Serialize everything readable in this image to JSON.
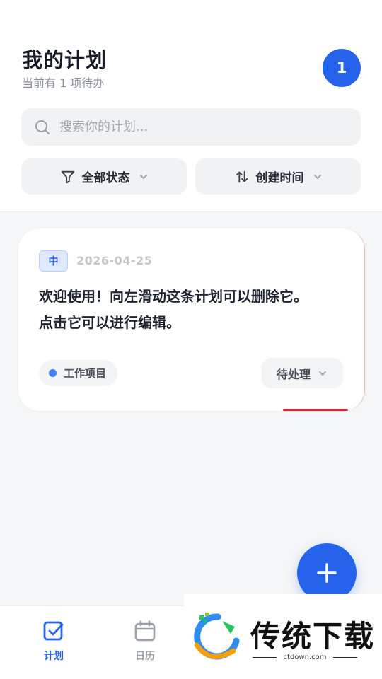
{
  "header": {
    "title": "我的计划",
    "subtitle": "当前有 1 项待办",
    "count_badge": "1"
  },
  "search": {
    "placeholder": "搜索你的计划...",
    "value": "",
    "icon": "search-icon"
  },
  "filters": {
    "status": {
      "label": "全部状态",
      "icon": "filter-icon"
    },
    "sort": {
      "label": "创建时间",
      "icon": "sort-icon"
    }
  },
  "plans": [
    {
      "priority": "中",
      "date": "2026-04-25",
      "content": "欢迎使用！向左滑动这条计划可以删除它。\n点击它可以进行编辑。",
      "category": "工作项目",
      "category_color": "#3b82f6",
      "status": "待处理"
    }
  ],
  "fab": {
    "icon": "plus-icon"
  },
  "tabbar": {
    "items": [
      {
        "label": "计划",
        "icon": "checkbox-icon",
        "active": true
      },
      {
        "label": "日历",
        "icon": "calendar-icon",
        "active": false
      }
    ]
  },
  "watermark": {
    "name": "传统下载",
    "url": "ctdown.com"
  },
  "colors": {
    "accent": "#2563eb",
    "background": "#f5f6f8",
    "card": "#ffffff",
    "delete_red": "#d9242f"
  }
}
